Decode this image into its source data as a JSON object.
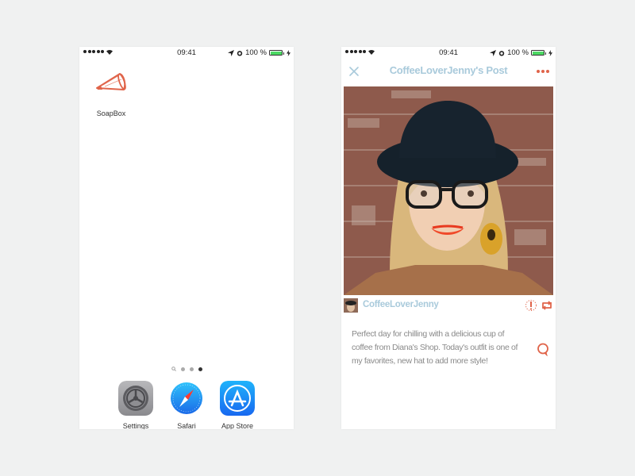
{
  "colors": {
    "accent": "#e0644a",
    "title_blue": "#a9cadb",
    "caption_gray": "#8a8a8a",
    "background": "#f0f1f1",
    "battery_green": "#4cd964"
  },
  "left_phone": {
    "status_bar": {
      "time": "09:41",
      "battery": "100 %",
      "icons": [
        "signal-dots",
        "wifi-icon",
        "location-arrow-icon",
        "alarm-icon",
        "battery-icon",
        "charging-bolt-icon"
      ]
    },
    "home_apps": [
      {
        "label": "SoapBox",
        "icon": "megaphone-icon"
      }
    ],
    "page_indicator": {
      "pages": 3,
      "current": 3,
      "has_search_page": true
    },
    "dock": [
      {
        "label": "Settings",
        "icon": "gear-icon"
      },
      {
        "label": "Safari",
        "icon": "compass-icon"
      },
      {
        "label": "App Store",
        "icon": "app-store-icon"
      }
    ]
  },
  "right_phone": {
    "status_bar": {
      "time": "09:41",
      "battery": "100 %"
    },
    "navbar": {
      "title": "CoffeeLoverJenny's Post",
      "close_icon": "close-icon",
      "more_icon": "more-dots-icon"
    },
    "post": {
      "image_alt": "Woman with black hat, glasses and orange earring in front of a brick wall",
      "author": "CoffeeLoverJenny",
      "actions": [
        "report-icon",
        "repost-icon"
      ],
      "caption": "Perfect day for chilling with a delicious cup of coffee from Diana's Shop. Today's outfit is one of my favorites, new hat to add more style!",
      "comment_icon": "comment-icon"
    }
  }
}
